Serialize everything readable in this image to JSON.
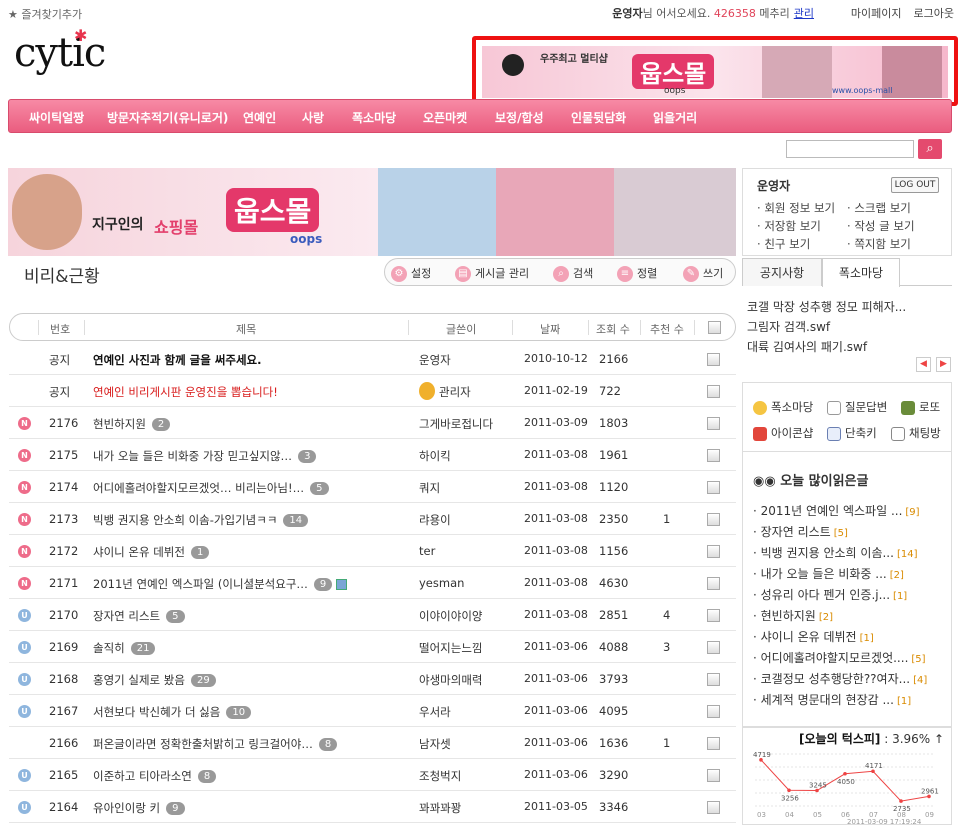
{
  "topbar": {
    "favorite": "즐겨찾기추가",
    "username": "운영자",
    "greeting_suffix": "님 어서오세요.",
    "points": "426358",
    "points_unit": "메추리",
    "admin_link": "관리",
    "mypage": "마이페이지",
    "logout": "로그아웃"
  },
  "logo": "cytic",
  "ad_top": {
    "small": "우주최고 멀티샵",
    "brand": "웁스몰",
    "sub": "oops",
    "url": "www.oops-mall"
  },
  "nav": [
    "싸이틱얼짱",
    "방문자추적기(유니로거)",
    "연예인",
    "사랑",
    "폭소마당",
    "오픈마켓",
    "보정/합성",
    "인물뒷담화",
    "읽을거리"
  ],
  "banner": {
    "tag": "지구인의",
    "tag2": "쇼핑몰",
    "brand": "웁스몰",
    "sub": "oops"
  },
  "board": {
    "title": "비리&근황",
    "tools": [
      "설정",
      "게시글 관리",
      "검색",
      "정렬",
      "쓰기"
    ],
    "headers": [
      "번호",
      "제목",
      "글쓴이",
      "날짜",
      "조회 수",
      "추천 수"
    ],
    "rows": [
      {
        "type": "notice",
        "num": "공지",
        "title": "연예인 사진과 함께 글을 써주세요.",
        "count": "",
        "author": "운영자",
        "date": "2010-10-12",
        "views": "2166",
        "rec": ""
      },
      {
        "type": "notice-red",
        "num": "공지",
        "title": "연예인 비리게시판 운영진을 뽑습니다!",
        "count": "",
        "author": "관리자",
        "date": "2011-02-19",
        "views": "722",
        "rec": ""
      },
      {
        "type": "N",
        "num": "2176",
        "title": "현빈하지원",
        "count": "2",
        "author": "그게바로접니다",
        "date": "2011-03-09",
        "views": "1803",
        "rec": ""
      },
      {
        "type": "N",
        "num": "2175",
        "title": "내가 오늘 들은 비화중 가장 믿고싶지않…",
        "count": "3",
        "author": "하이킥",
        "date": "2011-03-08",
        "views": "1961",
        "rec": ""
      },
      {
        "type": "N",
        "num": "2174",
        "title": "어디에홀려야할지모르겠엇… 비리는아님!…",
        "count": "5",
        "author": "쿼지",
        "date": "2011-03-08",
        "views": "1120",
        "rec": ""
      },
      {
        "type": "N",
        "num": "2173",
        "title": "빅뱅 권지용 안소희 이솜-가입기념ㅋㅋ",
        "count": "14",
        "author": "랴용이",
        "date": "2011-03-08",
        "views": "2350",
        "rec": "1"
      },
      {
        "type": "N",
        "num": "2172",
        "title": "샤이니 온유 데뷔전",
        "count": "1",
        "author": "ter",
        "date": "2011-03-08",
        "views": "1156",
        "rec": ""
      },
      {
        "type": "N",
        "num": "2171",
        "title": "2011년 연예인 엑스파일 (이니셜분석요구…",
        "count": "9",
        "author": "yesman",
        "date": "2011-03-08",
        "views": "4630",
        "rec": ""
      },
      {
        "type": "U",
        "num": "2170",
        "title": "장자연 리스트",
        "count": "5",
        "author": "이야이야이양",
        "date": "2011-03-08",
        "views": "2851",
        "rec": "4"
      },
      {
        "type": "U",
        "num": "2169",
        "title": "솔직히",
        "count": "21",
        "author": "떨어지는느낌",
        "date": "2011-03-06",
        "views": "4088",
        "rec": "3"
      },
      {
        "type": "U",
        "num": "2168",
        "title": "홍영기 실제로 봤음",
        "count": "29",
        "author": "야생마의매력",
        "date": "2011-03-06",
        "views": "3793",
        "rec": ""
      },
      {
        "type": "U",
        "num": "2167",
        "title": "서현보다 박신혜가 더 싫음",
        "count": "10",
        "author": "우서라",
        "date": "2011-03-06",
        "views": "4095",
        "rec": ""
      },
      {
        "type": "",
        "num": "2166",
        "title": "퍼온글이라면 정확한출처밝히고 링크걸어야…",
        "count": "8",
        "author": "남자셋",
        "date": "2011-03-06",
        "views": "1636",
        "rec": "1"
      },
      {
        "type": "U",
        "num": "2165",
        "title": "이준하고 티아라소연",
        "count": "8",
        "author": "조청벅지",
        "date": "2011-03-06",
        "views": "3290",
        "rec": ""
      },
      {
        "type": "U",
        "num": "2164",
        "title": "유아인이랑 키",
        "count": "9",
        "author": "꽈꽈꽈꽝",
        "date": "2011-03-05",
        "views": "3346",
        "rec": ""
      }
    ]
  },
  "sidebar": {
    "user": "운영자",
    "logout_btn": "LOG OUT",
    "links": [
      "회원 정보 보기",
      "스크랩 보기",
      "저장함 보기",
      "작성 글 보기",
      "친구 보기",
      "쪽지함 보기"
    ],
    "tabs": [
      "공지사항",
      "폭소마당"
    ],
    "notices": [
      "코갤 막장 성추행 정모 피해자...",
      "그림자 검객.swf",
      "대륙 김여사의 패기.swf"
    ],
    "quick": [
      "폭소마당",
      "질문답변",
      "로또",
      "아이콘샵",
      "단축키",
      "채팅방"
    ],
    "popular_title": "오늘 많이읽은글",
    "popular": [
      {
        "t": "2011년 연예인 엑스파일 ...",
        "n": "[9]"
      },
      {
        "t": "장자연 리스트",
        "n": "[5]"
      },
      {
        "t": "빅뱅 권지용 안소희 이솜...",
        "n": "[14]"
      },
      {
        "t": "내가 오늘 들은 비화중 ...",
        "n": "[2]"
      },
      {
        "t": "성유리 아다 펜거 인증.j...",
        "n": "[1]"
      },
      {
        "t": "현빈하지원",
        "n": "[2]"
      },
      {
        "t": "샤이니 온유 데뷔전",
        "n": "[1]"
      },
      {
        "t": "어디에홀려야할지모르겠엇....",
        "n": "[5]"
      },
      {
        "t": "코갤정모 성추행당한??여자...",
        "n": "[4]"
      },
      {
        "t": "세계적 명문대의 현장감 ...",
        "n": "[1]"
      }
    ],
    "stock_title": "[오늘의 턱스피]",
    "stock_value": ": 3.96% ↑"
  },
  "chart_data": {
    "type": "line",
    "x": [
      "03",
      "04",
      "05",
      "06",
      "07",
      "08",
      "09"
    ],
    "values": [
      4719,
      3256,
      3245,
      4050,
      4171,
      2735,
      2961
    ],
    "timestamp": "2011-03-09 17:19:24"
  },
  "colors": {
    "accent": "#e8507a",
    "nav": "#f07596",
    "new_badge": "#ee6c8a",
    "up_badge": "#8fb6de",
    "red_text": "#d81b1b"
  }
}
